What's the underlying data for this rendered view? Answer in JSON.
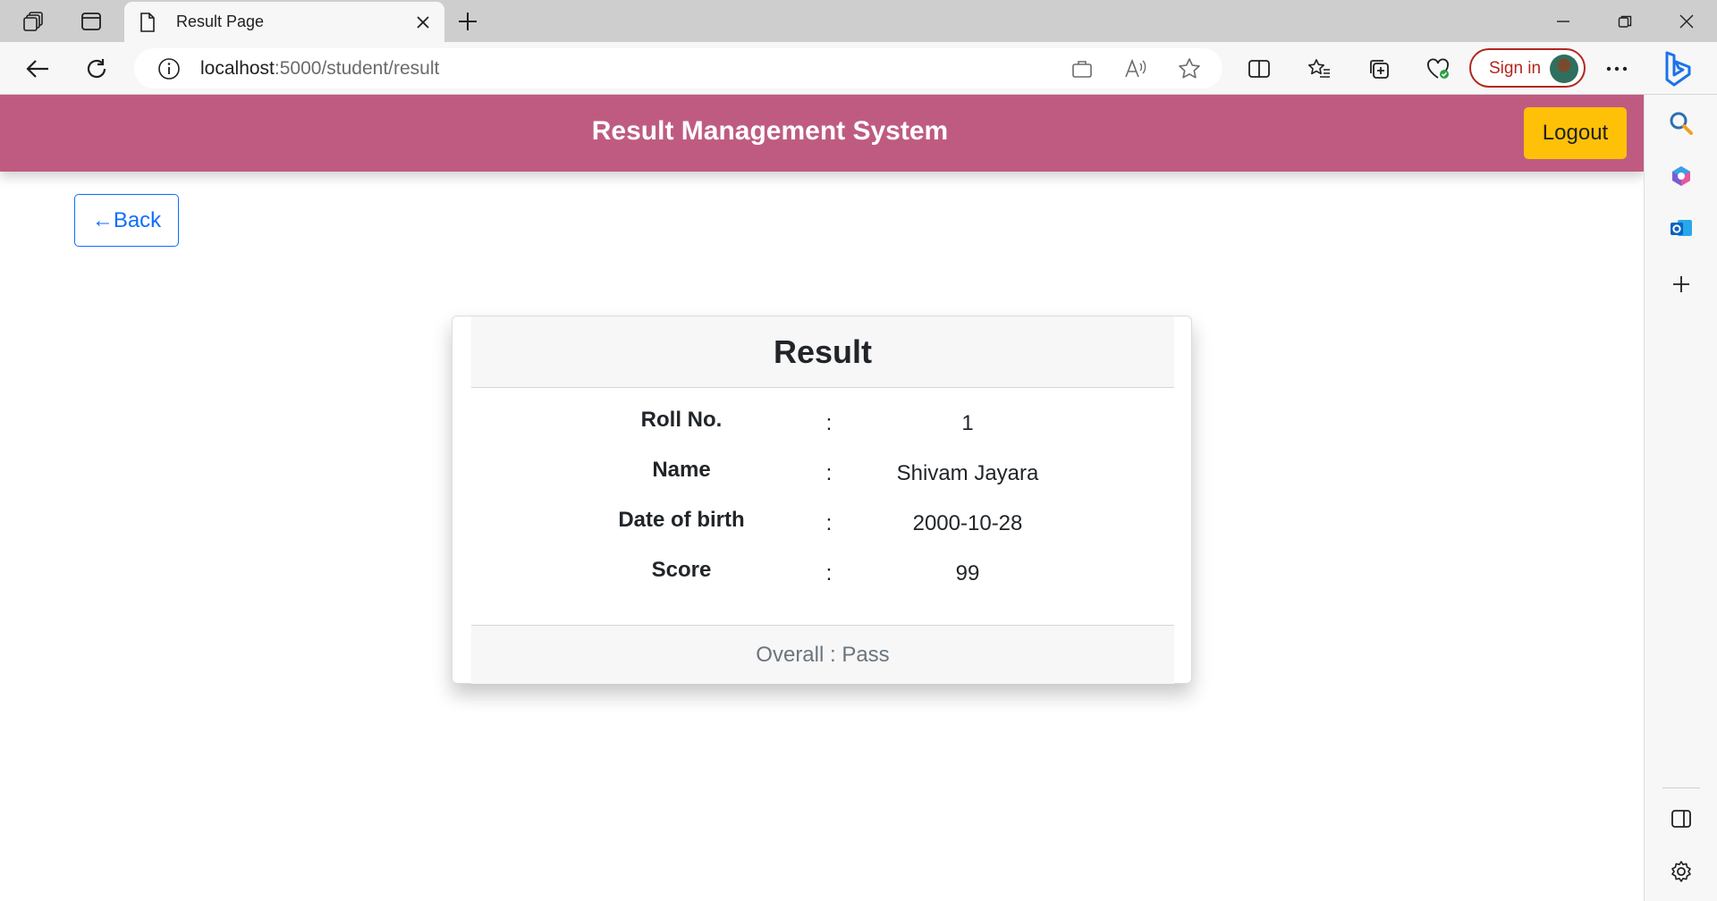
{
  "browser": {
    "tab_title": "Result Page",
    "url_host": "localhost",
    "url_path": ":5000/student/result",
    "signin_label": "Sign in"
  },
  "app": {
    "title": "Result Management System",
    "logout_label": "Logout",
    "back_label": "←Back",
    "accent_color": "#bf5b81",
    "logout_color": "#ffc107",
    "back_color": "#0d6efd"
  },
  "result": {
    "title": "Result",
    "separator": ":",
    "rows": [
      {
        "label": "Roll No.",
        "value": "1"
      },
      {
        "label": "Name",
        "value": "Shivam Jayara"
      },
      {
        "label": "Date of birth",
        "value": "2000-10-28"
      },
      {
        "label": "Score",
        "value": "99"
      }
    ],
    "overall": "Overall : Pass"
  }
}
